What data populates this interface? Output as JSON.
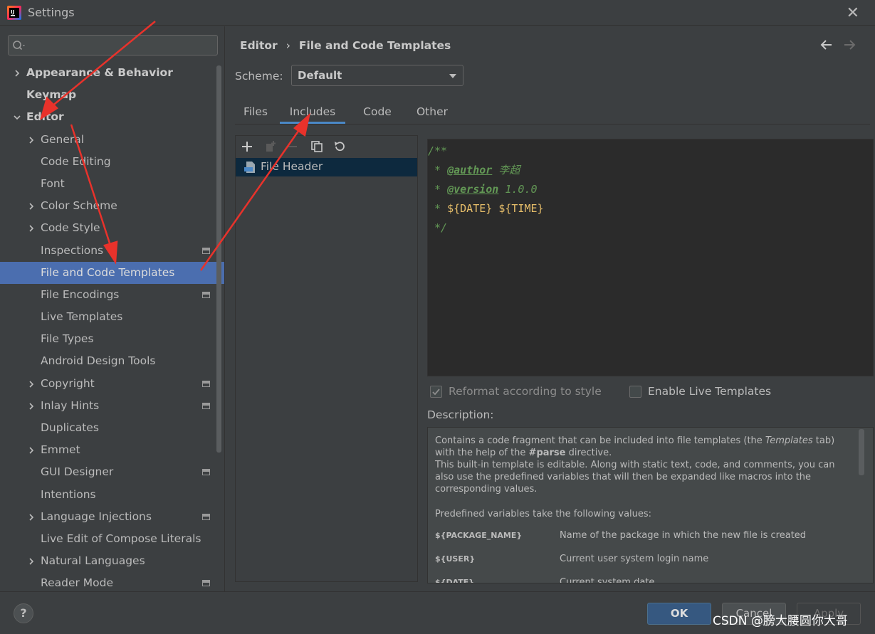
{
  "window": {
    "title": "Settings"
  },
  "search": {
    "placeholder": ""
  },
  "sidebar": {
    "items": [
      {
        "label": "Appearance & Behavior",
        "bold": true,
        "expandable": true,
        "expanded": false,
        "indent": 0
      },
      {
        "label": "Keymap",
        "bold": true,
        "expandable": false,
        "indent": 0
      },
      {
        "label": "Editor",
        "bold": true,
        "expandable": true,
        "expanded": true,
        "indent": 0
      },
      {
        "label": "General",
        "expandable": true,
        "indent": 1
      },
      {
        "label": "Code Editing",
        "indent": 1
      },
      {
        "label": "Font",
        "indent": 1
      },
      {
        "label": "Color Scheme",
        "expandable": true,
        "indent": 1
      },
      {
        "label": "Code Style",
        "expandable": true,
        "indent": 1
      },
      {
        "label": "Inspections",
        "indent": 1,
        "modified": true
      },
      {
        "label": "File and Code Templates",
        "indent": 1,
        "selected": true
      },
      {
        "label": "File Encodings",
        "indent": 1,
        "modified": true
      },
      {
        "label": "Live Templates",
        "indent": 1
      },
      {
        "label": "File Types",
        "indent": 1
      },
      {
        "label": "Android Design Tools",
        "indent": 1
      },
      {
        "label": "Copyright",
        "expandable": true,
        "indent": 1,
        "modified": true
      },
      {
        "label": "Inlay Hints",
        "expandable": true,
        "indent": 1,
        "modified": true
      },
      {
        "label": "Duplicates",
        "indent": 1
      },
      {
        "label": "Emmet",
        "expandable": true,
        "indent": 1
      },
      {
        "label": "GUI Designer",
        "indent": 1,
        "modified": true
      },
      {
        "label": "Intentions",
        "indent": 1
      },
      {
        "label": "Language Injections",
        "expandable": true,
        "indent": 1,
        "modified": true
      },
      {
        "label": "Live Edit of Compose Literals",
        "indent": 1
      },
      {
        "label": "Natural Languages",
        "expandable": true,
        "indent": 1
      },
      {
        "label": "Reader Mode",
        "indent": 1,
        "modified": true
      }
    ]
  },
  "breadcrumb": {
    "parent": "Editor",
    "separator": "›",
    "current": "File and Code Templates"
  },
  "scheme": {
    "label": "Scheme:",
    "value": "Default"
  },
  "tabs": [
    "Files",
    "Includes",
    "Code",
    "Other"
  ],
  "active_tab": "Includes",
  "template_list": {
    "items": [
      "File Header"
    ]
  },
  "editor": {
    "lines": [
      {
        "text": "/**"
      },
      {
        "prefix": " * ",
        "tag": "@author",
        "rest": " 李超"
      },
      {
        "prefix": " * ",
        "tag": "@version",
        "rest": " 1.0.0"
      },
      {
        "prefix": " * ",
        "var1": "${DATE}",
        "space": " ",
        "var2": "${TIME}"
      },
      {
        "text": " */"
      }
    ]
  },
  "options": {
    "reformat": {
      "label": "Reformat according to style",
      "checked": true,
      "enabled": false
    },
    "live_templates": {
      "label": "Enable Live Templates",
      "checked": false,
      "enabled": true
    }
  },
  "description": {
    "label": "Description:",
    "para1_a": "Contains a code fragment that can be included into file templates (the ",
    "para1_em": "Templates",
    "para1_b": " tab) with the help of the ",
    "para1_strong": "#parse",
    "para1_c": " directive.",
    "para2": "This built-in template is editable. Along with static text, code, and comments, you can also use the predefined variables that will then be expanded like macros into the corresponding values.",
    "para3": "Predefined variables take the following values:",
    "vars": [
      {
        "name": "${PACKAGE_NAME}",
        "desc": "Name of the package in which the new file is created"
      },
      {
        "name": "${USER}",
        "desc": "Current user system login name"
      },
      {
        "name": "${DATE}",
        "desc": "Current system date"
      }
    ]
  },
  "footer": {
    "help": "?",
    "ok": "OK",
    "cancel": "Cancel",
    "apply": "Apply"
  },
  "watermark": "CSDN @膀大腰圆你大哥",
  "colors": {
    "accent": "#4b6eaf",
    "annotation_arrow": "#e8322b",
    "comment": "#629755",
    "variable": "#e8bf6a"
  }
}
